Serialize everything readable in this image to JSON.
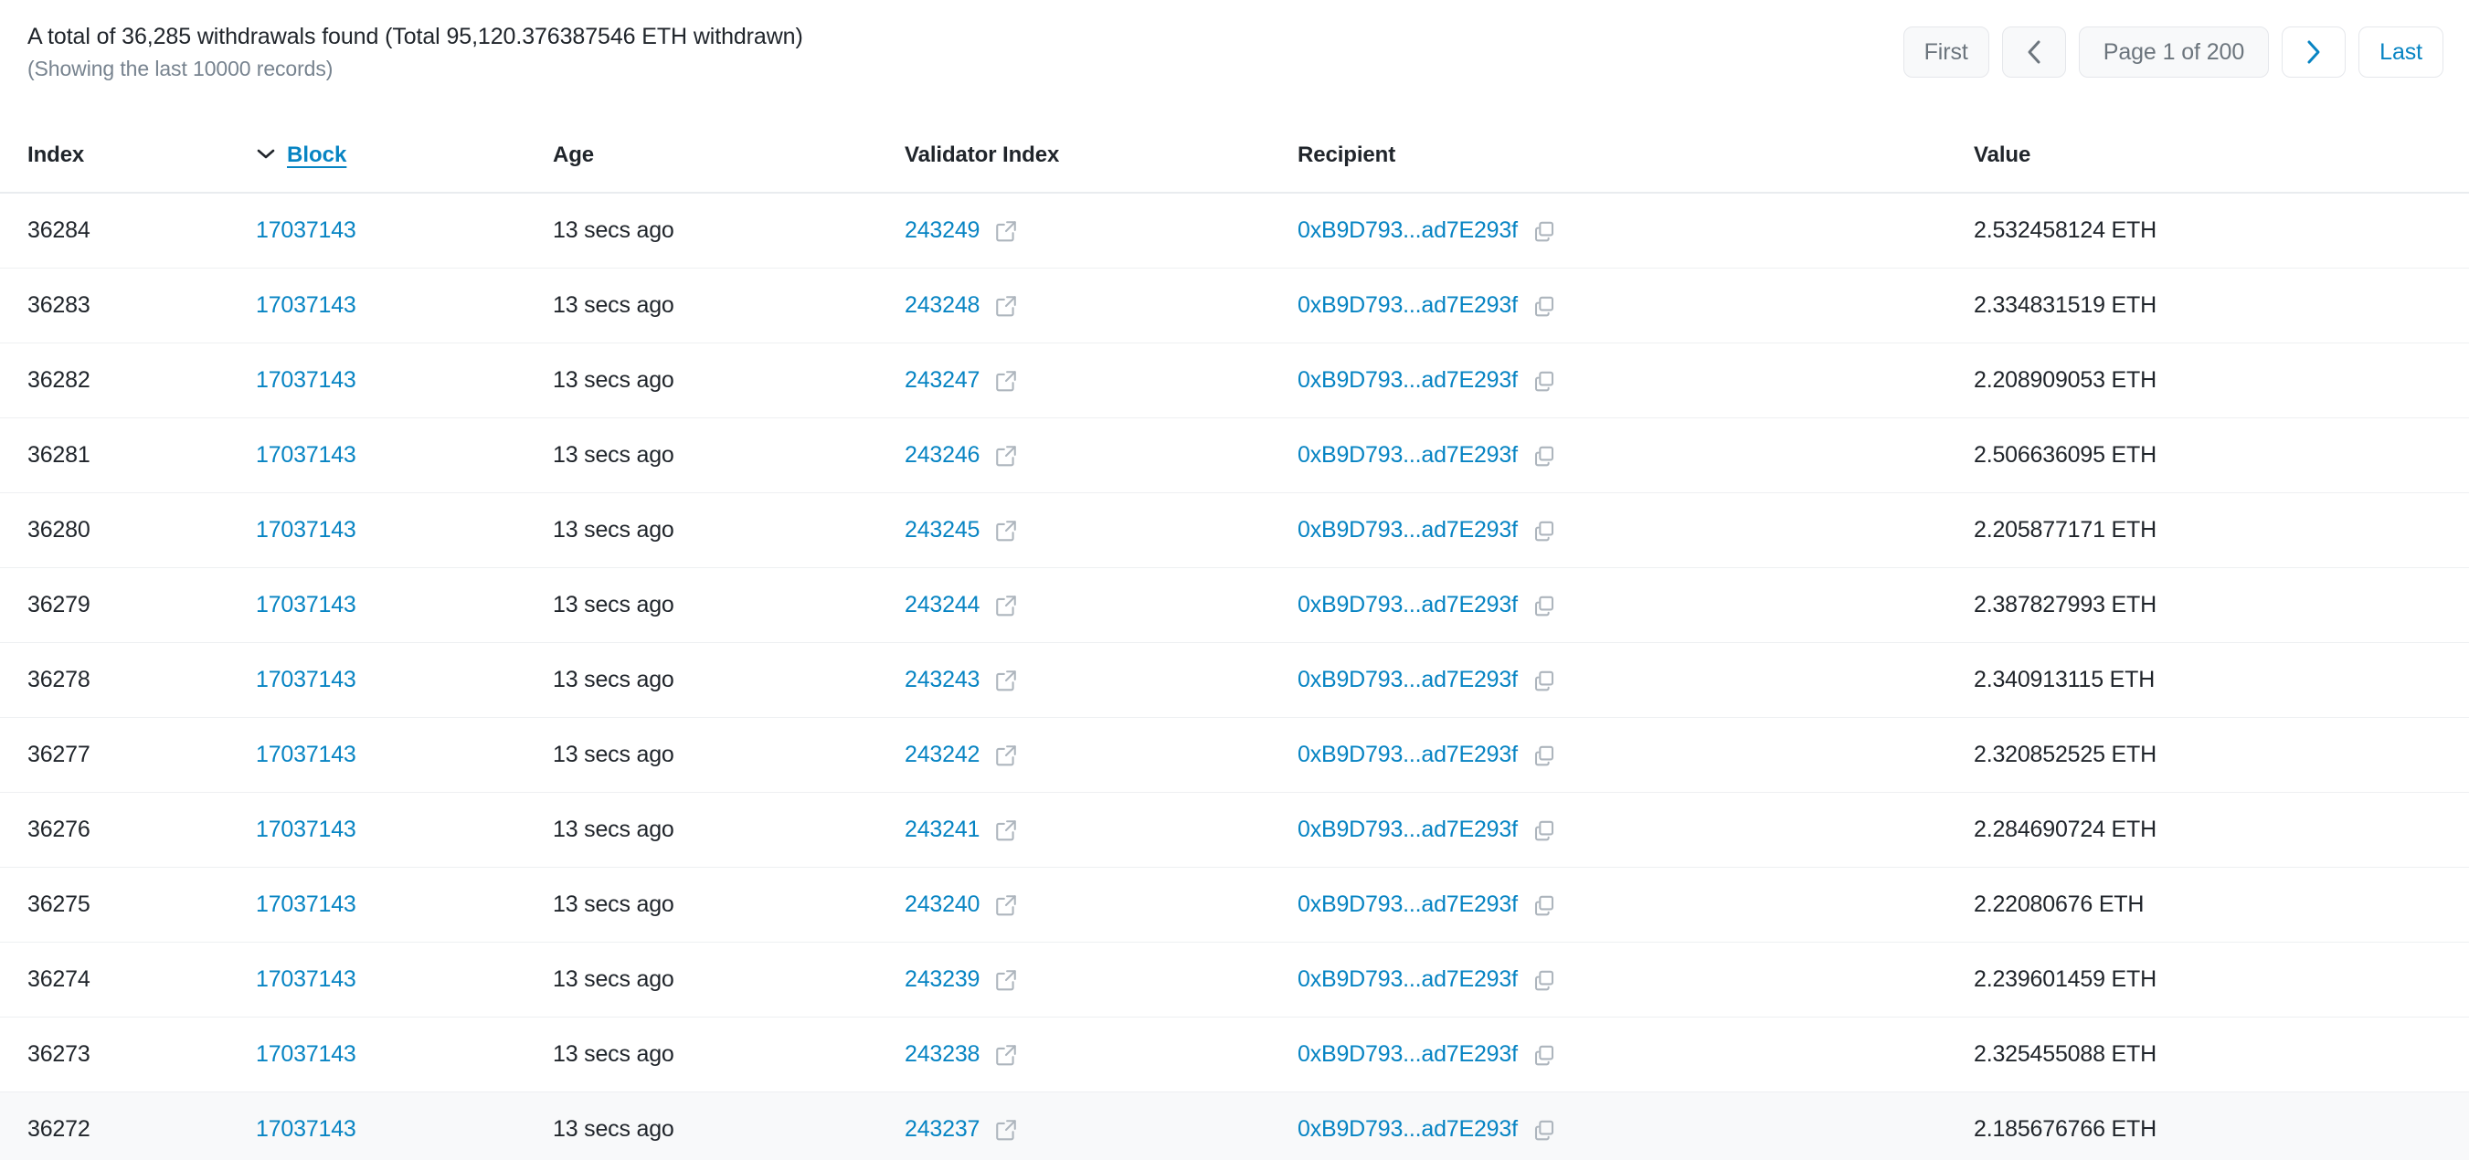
{
  "summary": {
    "title": "A total of 36,285 withdrawals found (Total 95,120.376387546 ETH withdrawn)",
    "subtitle": "(Showing the last 10000 records)"
  },
  "pagination": {
    "first_label": "First",
    "prev_icon": "chevron-left-icon",
    "page_label": "Page 1 of 200",
    "next_icon": "chevron-right-icon",
    "last_label": "Last",
    "current_page": 1,
    "total_pages": 200,
    "disabled_color": "#6c757d",
    "active_color": "#0784c3"
  },
  "table": {
    "columns": [
      {
        "key": "index",
        "label": "Index",
        "sortable": false
      },
      {
        "key": "block",
        "label": "Block",
        "sortable": true,
        "sort_direction": "desc",
        "sort_icon": "chevron-down-icon"
      },
      {
        "key": "age",
        "label": "Age",
        "sortable": false
      },
      {
        "key": "validator_index",
        "label": "Validator Index",
        "sortable": false
      },
      {
        "key": "recipient",
        "label": "Recipient",
        "sortable": false
      },
      {
        "key": "value",
        "label": "Value",
        "sortable": false
      }
    ],
    "icons": {
      "external_link": "external-link-icon",
      "copy": "copy-icon"
    },
    "rows": [
      {
        "index": "36284",
        "block": "17037143",
        "age": "13 secs ago",
        "validator_index": "243249",
        "recipient": "0xB9D793...ad7E293f",
        "value": "2.532458124 ETH",
        "hovered": false
      },
      {
        "index": "36283",
        "block": "17037143",
        "age": "13 secs ago",
        "validator_index": "243248",
        "recipient": "0xB9D793...ad7E293f",
        "value": "2.334831519 ETH",
        "hovered": false
      },
      {
        "index": "36282",
        "block": "17037143",
        "age": "13 secs ago",
        "validator_index": "243247",
        "recipient": "0xB9D793...ad7E293f",
        "value": "2.208909053 ETH",
        "hovered": false
      },
      {
        "index": "36281",
        "block": "17037143",
        "age": "13 secs ago",
        "validator_index": "243246",
        "recipient": "0xB9D793...ad7E293f",
        "value": "2.506636095 ETH",
        "hovered": false
      },
      {
        "index": "36280",
        "block": "17037143",
        "age": "13 secs ago",
        "validator_index": "243245",
        "recipient": "0xB9D793...ad7E293f",
        "value": "2.205877171 ETH",
        "hovered": false
      },
      {
        "index": "36279",
        "block": "17037143",
        "age": "13 secs ago",
        "validator_index": "243244",
        "recipient": "0xB9D793...ad7E293f",
        "value": "2.387827993 ETH",
        "hovered": false
      },
      {
        "index": "36278",
        "block": "17037143",
        "age": "13 secs ago",
        "validator_index": "243243",
        "recipient": "0xB9D793...ad7E293f",
        "value": "2.340913115 ETH",
        "hovered": false
      },
      {
        "index": "36277",
        "block": "17037143",
        "age": "13 secs ago",
        "validator_index": "243242",
        "recipient": "0xB9D793...ad7E293f",
        "value": "2.320852525 ETH",
        "hovered": false
      },
      {
        "index": "36276",
        "block": "17037143",
        "age": "13 secs ago",
        "validator_index": "243241",
        "recipient": "0xB9D793...ad7E293f",
        "value": "2.284690724 ETH",
        "hovered": false
      },
      {
        "index": "36275",
        "block": "17037143",
        "age": "13 secs ago",
        "validator_index": "243240",
        "recipient": "0xB9D793...ad7E293f",
        "value": "2.22080676 ETH",
        "hovered": false
      },
      {
        "index": "36274",
        "block": "17037143",
        "age": "13 secs ago",
        "validator_index": "243239",
        "recipient": "0xB9D793...ad7E293f",
        "value": "2.239601459 ETH",
        "hovered": false
      },
      {
        "index": "36273",
        "block": "17037143",
        "age": "13 secs ago",
        "validator_index": "243238",
        "recipient": "0xB9D793...ad7E293f",
        "value": "2.325455088 ETH",
        "hovered": false
      },
      {
        "index": "36272",
        "block": "17037143",
        "age": "13 secs ago",
        "validator_index": "243237",
        "recipient": "0xB9D793...ad7E293f",
        "value": "2.185676766 ETH",
        "hovered": true
      }
    ]
  }
}
